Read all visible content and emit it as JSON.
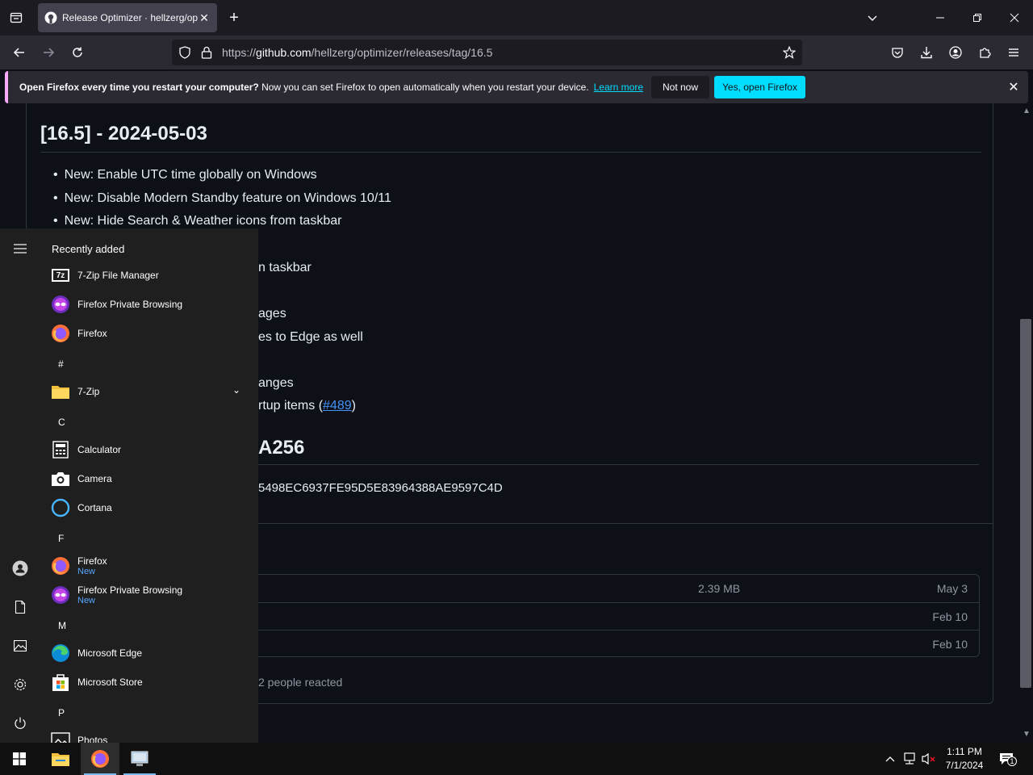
{
  "browser": {
    "tab": {
      "title": "Release Optimizer · hellzerg/optimizer"
    },
    "url": {
      "scheme": "https://",
      "host": "github.com",
      "path": "/hellzerg/optimizer/releases/tag/16.5"
    },
    "notification": {
      "bold": "Open Firefox every time you restart your computer?",
      "text": " Now you can set Firefox to open automatically when you restart your device.",
      "link": "Learn more",
      "not_now": "Not now",
      "yes": "Yes, open Firefox"
    }
  },
  "release": {
    "title": "[16.5] - 2024-05-03",
    "bullets": [
      "New: Enable UTC time globally on Windows",
      "New: Disable Modern Standby feature on Windows 10/11",
      "New: Hide Search & Weather icons from taskbar"
    ],
    "fragments": [
      "n taskbar",
      "ages",
      "es to Edge as well",
      "anges"
    ],
    "startup_prefix": "rtup items (",
    "startup_link": "#489",
    "startup_suffix": ")",
    "sha_title": "A256",
    "hash": "5498EC6937FE95D5E83964388AE9597C4D",
    "assets": [
      {
        "size": "2.39 MB",
        "date": "May 3"
      },
      {
        "size": "",
        "date": "Feb 10"
      },
      {
        "size": "",
        "date": "Feb 10"
      }
    ],
    "reacted": "2 people reacted"
  },
  "start_menu": {
    "recently_added": "Recently added",
    "recent": [
      "7-Zip File Manager",
      "Firefox Private Browsing",
      "Firefox"
    ],
    "letters": [
      "#",
      "C",
      "F",
      "M",
      "P"
    ],
    "hash_group": [
      "7-Zip"
    ],
    "c_group": [
      "Calculator",
      "Camera",
      "Cortana"
    ],
    "f_group": [
      {
        "name": "Firefox",
        "badge": "New"
      },
      {
        "name": "Firefox Private Browsing",
        "badge": "New"
      }
    ],
    "m_group": [
      "Microsoft Edge",
      "Microsoft Store"
    ],
    "p_group": [
      "Photos"
    ]
  },
  "taskbar": {
    "time": "1:11 PM",
    "date": "7/1/2024",
    "notif_count": "1"
  },
  "colors": {
    "accent": "#00ddff",
    "link": "#4493f8",
    "badge_new": "#58a6ff"
  }
}
